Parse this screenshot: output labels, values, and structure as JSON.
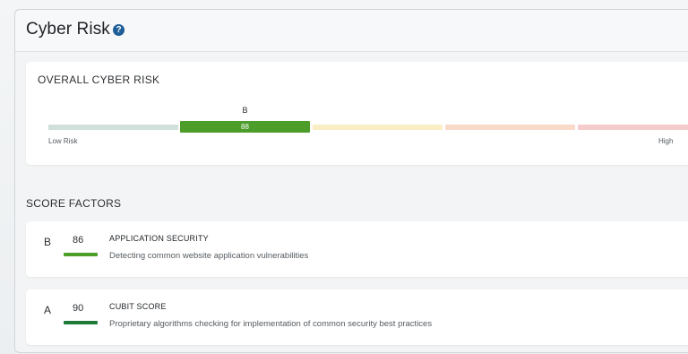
{
  "window": {
    "title": "Cyber Risk"
  },
  "overall": {
    "heading": "OVERALL CYBER RISK",
    "grade": "B",
    "score": "88",
    "low_label": "Low Risk",
    "high_label": "High",
    "segments": [
      {
        "color": "#cfe1d8"
      },
      {
        "color": "#4c9d2a",
        "active": true
      },
      {
        "color": "#fbedc4"
      },
      {
        "color": "#f9d9c8"
      },
      {
        "color": "#f5cccc"
      }
    ]
  },
  "factors_section": {
    "heading": "SCORE FACTORS"
  },
  "factors": [
    {
      "grade": "B",
      "score": "86",
      "name": "APPLICATION SECURITY",
      "description": "Detecting common website application vulnerabilities",
      "bar_color": "#4c9d2a"
    },
    {
      "grade": "A",
      "score": "90",
      "name": "CUBIT SCORE",
      "description": "Proprietary algorithms checking for implementation of common security best practices",
      "bar_color": "#1f7a3a"
    }
  ],
  "icons": {
    "help": "question-circle-icon"
  },
  "colors": {
    "accent": "#1e5f9a",
    "grade_b": "#4c9d2a",
    "grade_a": "#1f7a3a"
  }
}
